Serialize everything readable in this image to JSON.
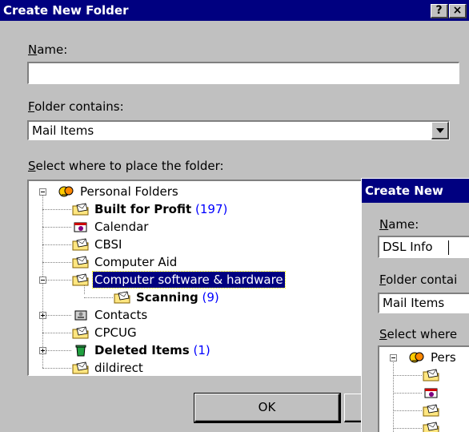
{
  "main_dialog": {
    "title": "Create New Folder",
    "help_btn": "?",
    "close_btn": "×",
    "name_label_key": "N",
    "name_label_rest": "ame:",
    "name_value": "",
    "contains_label_key": "F",
    "contains_label_rest": "older contains:",
    "contains_value": "Mail Items",
    "place_label_key": "S",
    "place_label_rest": "elect where to place the folder:",
    "tree": [
      {
        "label": "Personal Folders",
        "count": "",
        "icon": "personal-folders-icon",
        "bold": false,
        "selected": false
      },
      {
        "label": "Built for Profit",
        "count": "(197)",
        "icon": "mail-folder-icon",
        "bold": true,
        "selected": false
      },
      {
        "label": "Calendar",
        "count": "",
        "icon": "calendar-icon",
        "bold": false,
        "selected": false
      },
      {
        "label": "CBSI",
        "count": "",
        "icon": "mail-folder-icon",
        "bold": false,
        "selected": false
      },
      {
        "label": "Computer Aid",
        "count": "",
        "icon": "mail-folder-icon",
        "bold": false,
        "selected": false
      },
      {
        "label": "Computer software & hardware",
        "count": "",
        "icon": "mail-folder-icon",
        "bold": false,
        "selected": true
      },
      {
        "label": "Scanning",
        "count": "(9)",
        "icon": "mail-folder-icon",
        "bold": true,
        "selected": false
      },
      {
        "label": "Contacts",
        "count": "",
        "icon": "contacts-icon",
        "bold": false,
        "selected": false
      },
      {
        "label": "CPCUG",
        "count": "",
        "icon": "mail-folder-icon",
        "bold": false,
        "selected": false
      },
      {
        "label": "Deleted Items",
        "count": "(1)",
        "icon": "deleted-items-icon",
        "bold": true,
        "selected": false
      },
      {
        "label": "dildirect",
        "count": "",
        "icon": "mail-folder-icon",
        "bold": false,
        "selected": false
      }
    ],
    "ok_label": "OK"
  },
  "second_dialog": {
    "title": "Create New",
    "name_label_key": "N",
    "name_label_rest": "ame:",
    "name_value": "DSL Info",
    "contains_label_key": "F",
    "contains_label_rest": "older contai",
    "contains_value": "Mail Items",
    "place_label_key": "S",
    "place_label_rest": "elect where",
    "tree_root_label": "Pers"
  }
}
